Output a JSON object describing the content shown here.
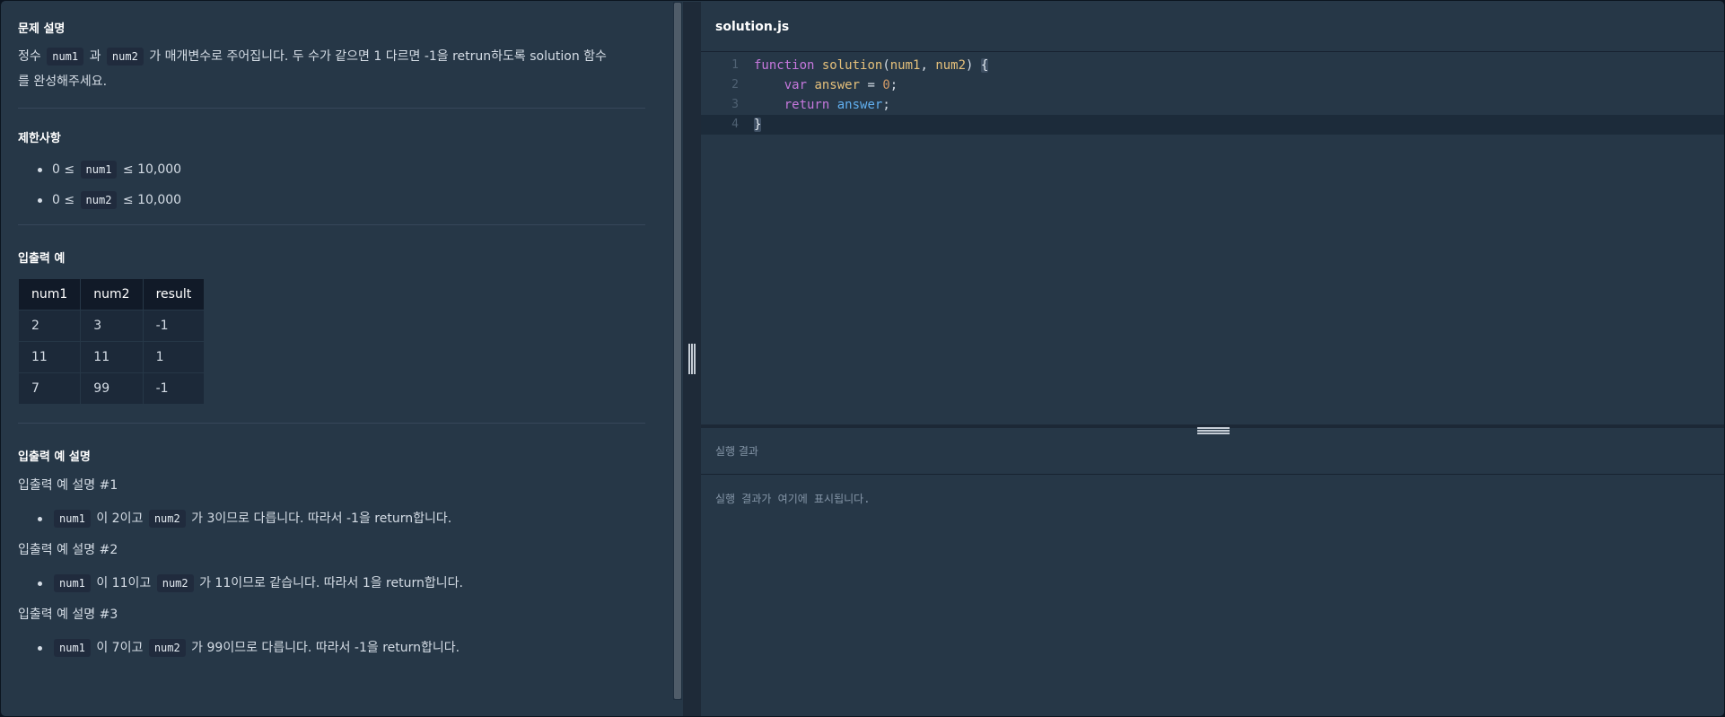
{
  "problem": {
    "description_title": "문제 설명",
    "description_parts": [
      "정수 ",
      "num1",
      " 과 ",
      "num2",
      " 가 매개변수로 주어집니다. 두 수가 같으면 1 다르면 -1을 retrun하도록 solution 함수",
      "를 완성해주세요."
    ],
    "constraints_title": "제한사항",
    "constraints": [
      {
        "pre": "0 ≤ ",
        "code": "num1",
        "post": " ≤ 10,000"
      },
      {
        "pre": "0 ≤ ",
        "code": "num2",
        "post": " ≤ 10,000"
      }
    ],
    "io_title": "입출력 예",
    "io_table": {
      "headers": [
        "num1",
        "num2",
        "result"
      ],
      "rows": [
        [
          "2",
          "3",
          "-1"
        ],
        [
          "11",
          "11",
          "1"
        ],
        [
          "7",
          "99",
          "-1"
        ]
      ]
    },
    "io_explain_title": "입출력 예 설명",
    "examples": [
      {
        "title": "입출력 예 설명 #1",
        "c1": "num1",
        "t1": " 이 2이고 ",
        "c2": "num2",
        "t2": " 가 3이므로 다릅니다. 따라서 -1을 return합니다."
      },
      {
        "title": "입출력 예 설명 #2",
        "c1": "num1",
        "t1": " 이 11이고 ",
        "c2": "num2",
        "t2": " 가 11이므로 같습니다. 따라서 1을 return합니다."
      },
      {
        "title": "입출력 예 설명 #3",
        "c1": "num1",
        "t1": " 이 7이고 ",
        "c2": "num2",
        "t2": " 가 99이므로 다릅니다. 따라서 -1을 return합니다."
      }
    ]
  },
  "editor": {
    "file_name": "solution.js",
    "line_numbers": [
      "1",
      "2",
      "3",
      "4"
    ],
    "code": {
      "l1_kw": "function",
      "l1_fn": "solution",
      "l1_open": "(",
      "l1_p1": "num1",
      "l1_comma": ", ",
      "l1_p2": "num2",
      "l1_close": ") ",
      "l1_brace": "{",
      "l2_indent": "    ",
      "l2_kw": "var",
      "l2_var": "answer",
      "l2_eq": " = ",
      "l2_num": "0",
      "l2_semi": ";",
      "l3_indent": "    ",
      "l3_kw": "return",
      "l3_var": "answer",
      "l3_semi": ";",
      "l4_brace": "}"
    }
  },
  "result": {
    "title": "실행 결과",
    "placeholder": "실행 결과가 여기에 표시됩니다."
  },
  "colors": {
    "panel_bg": "#263747",
    "keyword": "#c678dd",
    "function": "#e5c07b",
    "number": "#d19a66"
  }
}
